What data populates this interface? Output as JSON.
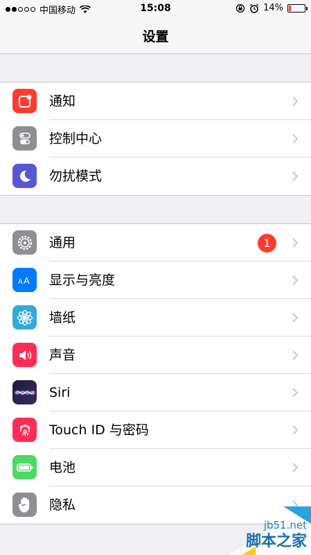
{
  "status_bar": {
    "carrier": "中国移动",
    "time": "15:08",
    "battery_percent": "14%"
  },
  "nav": {
    "title": "设置"
  },
  "groups": [
    {
      "items": [
        {
          "label": "通知",
          "icon": "notifications-icon",
          "color": "#ff3b30"
        },
        {
          "label": "控制中心",
          "icon": "control-center-icon",
          "color": "#8e8e93"
        },
        {
          "label": "勿扰模式",
          "icon": "moon-icon",
          "color": "#5856d6"
        }
      ]
    },
    {
      "items": [
        {
          "label": "通用",
          "icon": "gear-icon",
          "color": "#8e8e93",
          "badge": "1"
        },
        {
          "label": "显示与亮度",
          "icon": "display-brightness-icon",
          "color": "#007aff"
        },
        {
          "label": "墙纸",
          "icon": "wallpaper-icon",
          "color": "#34aadc"
        },
        {
          "label": "声音",
          "icon": "speaker-icon",
          "color": "#ff2d55"
        },
        {
          "label": "Siri",
          "icon": "siri-icon",
          "color": "#1c1c3a"
        },
        {
          "label": "Touch ID 与密码",
          "icon": "fingerprint-icon",
          "color": "#ff2d55"
        },
        {
          "label": "电池",
          "icon": "battery-icon",
          "color": "#4cd964"
        },
        {
          "label": "隐私",
          "icon": "hand-icon",
          "color": "#8e8e93"
        }
      ]
    }
  ],
  "watermark": {
    "line1": "jb51.net",
    "line2": "脚本之家"
  }
}
